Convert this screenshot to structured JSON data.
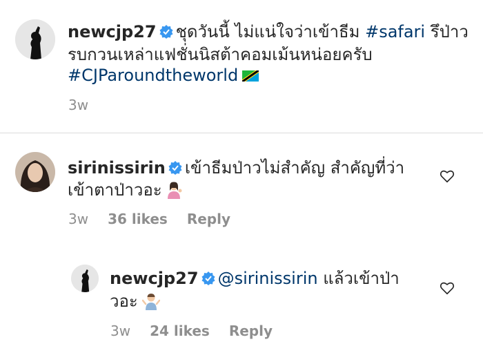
{
  "post": {
    "username": "newcjp27",
    "caption_line1_text": "ชุดวันนี้ ไม่แน่ใจว่าเข้าธีม",
    "caption_line1_tag": "#safari",
    "caption_line1_tail": "รึป่าว",
    "caption_line2": "รบกวนเหล่าแฟชั่นนิสต้าคอมเม้นหน่อยครับ",
    "caption_line3_tag": "#CJParoundtheworld",
    "flag_icon": "tanzania-flag-emoji",
    "time": "3w"
  },
  "comment1": {
    "username": "sirinissirin",
    "text_line1": "เข้าธีมป่าวไม่สำคัญ สำคัญที่ว่า",
    "text_line2": "เข้าตาป่าวอะ",
    "emoji": "person-tipping-hand-emoji",
    "time": "3w",
    "likes": "36 likes",
    "reply": "Reply"
  },
  "reply1": {
    "username": "newcjp27",
    "mention": "@sirinissirin",
    "text_line1": "แล้วเข้าป่า",
    "text_line2": "วอะ",
    "emoji": "man-shrugging-emoji",
    "time": "3w",
    "likes": "24 likes",
    "reply": "Reply"
  },
  "colors": {
    "text": "#262626",
    "muted": "#8e8e8e",
    "link": "#00376b",
    "verified": "#3897f0",
    "divider": "#dbdbdb"
  }
}
